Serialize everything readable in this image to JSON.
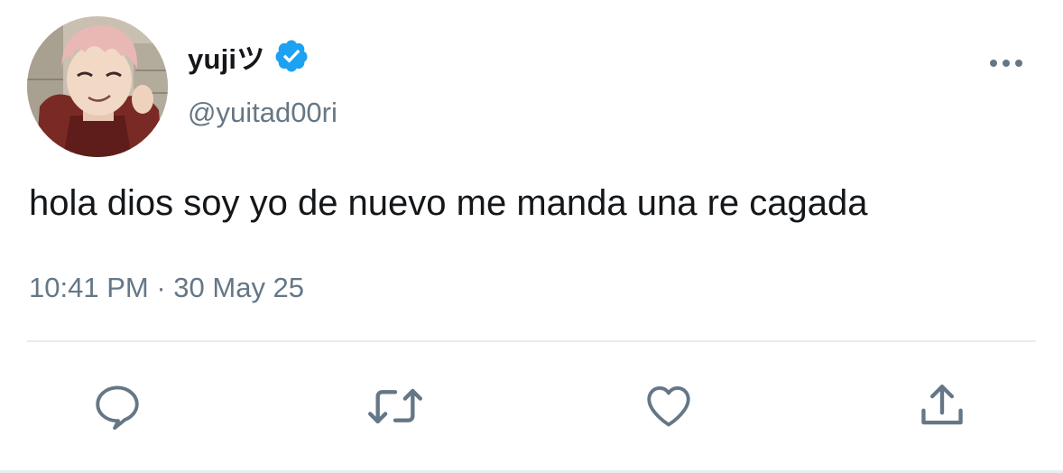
{
  "author": {
    "display_name": "yujiツ",
    "handle": "@yuitad00ri",
    "verified": true,
    "avatar_icon": "anime-character-avatar",
    "verified_icon": "verified-badge-icon",
    "verified_color": "#1da1f2"
  },
  "tweet": {
    "text": "hola dios soy yo de nuevo me manda una re cagada",
    "time": "10:41 PM",
    "separator": "·",
    "date": "30 May 25"
  },
  "actions": [
    {
      "name": "reply",
      "icon": "comment-icon"
    },
    {
      "name": "retweet",
      "icon": "retweet-icon"
    },
    {
      "name": "like",
      "icon": "heart-icon"
    },
    {
      "name": "share",
      "icon": "share-icon"
    }
  ],
  "menu": {
    "icon": "more-options-icon"
  },
  "colors": {
    "text_primary": "#14171a",
    "text_secondary": "#657786",
    "accent": "#1da1f2",
    "divider": "#e6ecf0"
  }
}
